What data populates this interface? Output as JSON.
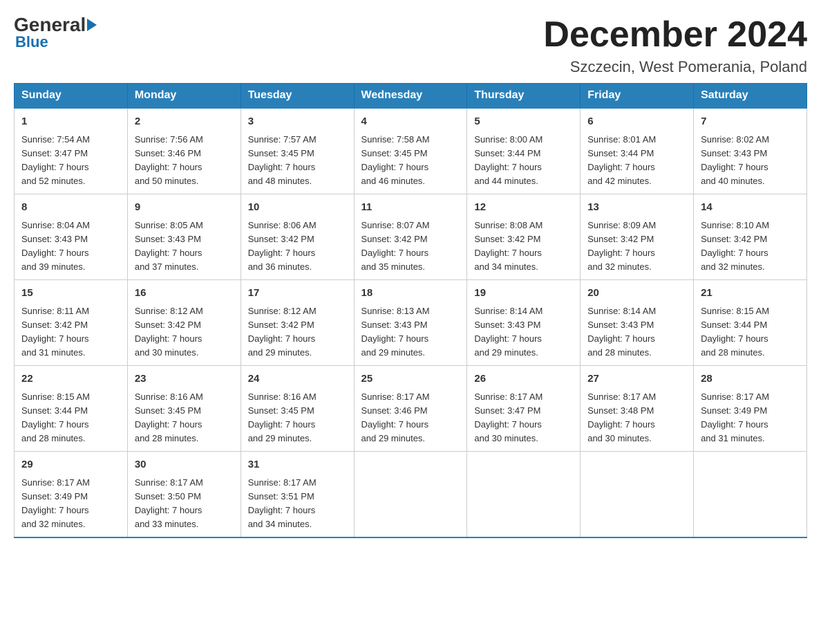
{
  "logo": {
    "general": "General",
    "blue": "Blue"
  },
  "title": "December 2024",
  "location": "Szczecin, West Pomerania, Poland",
  "weekdays": [
    "Sunday",
    "Monday",
    "Tuesday",
    "Wednesday",
    "Thursday",
    "Friday",
    "Saturday"
  ],
  "weeks": [
    [
      {
        "day": "1",
        "sunrise": "7:54 AM",
        "sunset": "3:47 PM",
        "daylight": "7 hours and 52 minutes."
      },
      {
        "day": "2",
        "sunrise": "7:56 AM",
        "sunset": "3:46 PM",
        "daylight": "7 hours and 50 minutes."
      },
      {
        "day": "3",
        "sunrise": "7:57 AM",
        "sunset": "3:45 PM",
        "daylight": "7 hours and 48 minutes."
      },
      {
        "day": "4",
        "sunrise": "7:58 AM",
        "sunset": "3:45 PM",
        "daylight": "7 hours and 46 minutes."
      },
      {
        "day": "5",
        "sunrise": "8:00 AM",
        "sunset": "3:44 PM",
        "daylight": "7 hours and 44 minutes."
      },
      {
        "day": "6",
        "sunrise": "8:01 AM",
        "sunset": "3:44 PM",
        "daylight": "7 hours and 42 minutes."
      },
      {
        "day": "7",
        "sunrise": "8:02 AM",
        "sunset": "3:43 PM",
        "daylight": "7 hours and 40 minutes."
      }
    ],
    [
      {
        "day": "8",
        "sunrise": "8:04 AM",
        "sunset": "3:43 PM",
        "daylight": "7 hours and 39 minutes."
      },
      {
        "day": "9",
        "sunrise": "8:05 AM",
        "sunset": "3:43 PM",
        "daylight": "7 hours and 37 minutes."
      },
      {
        "day": "10",
        "sunrise": "8:06 AM",
        "sunset": "3:42 PM",
        "daylight": "7 hours and 36 minutes."
      },
      {
        "day": "11",
        "sunrise": "8:07 AM",
        "sunset": "3:42 PM",
        "daylight": "7 hours and 35 minutes."
      },
      {
        "day": "12",
        "sunrise": "8:08 AM",
        "sunset": "3:42 PM",
        "daylight": "7 hours and 34 minutes."
      },
      {
        "day": "13",
        "sunrise": "8:09 AM",
        "sunset": "3:42 PM",
        "daylight": "7 hours and 32 minutes."
      },
      {
        "day": "14",
        "sunrise": "8:10 AM",
        "sunset": "3:42 PM",
        "daylight": "7 hours and 32 minutes."
      }
    ],
    [
      {
        "day": "15",
        "sunrise": "8:11 AM",
        "sunset": "3:42 PM",
        "daylight": "7 hours and 31 minutes."
      },
      {
        "day": "16",
        "sunrise": "8:12 AM",
        "sunset": "3:42 PM",
        "daylight": "7 hours and 30 minutes."
      },
      {
        "day": "17",
        "sunrise": "8:12 AM",
        "sunset": "3:42 PM",
        "daylight": "7 hours and 29 minutes."
      },
      {
        "day": "18",
        "sunrise": "8:13 AM",
        "sunset": "3:43 PM",
        "daylight": "7 hours and 29 minutes."
      },
      {
        "day": "19",
        "sunrise": "8:14 AM",
        "sunset": "3:43 PM",
        "daylight": "7 hours and 29 minutes."
      },
      {
        "day": "20",
        "sunrise": "8:14 AM",
        "sunset": "3:43 PM",
        "daylight": "7 hours and 28 minutes."
      },
      {
        "day": "21",
        "sunrise": "8:15 AM",
        "sunset": "3:44 PM",
        "daylight": "7 hours and 28 minutes."
      }
    ],
    [
      {
        "day": "22",
        "sunrise": "8:15 AM",
        "sunset": "3:44 PM",
        "daylight": "7 hours and 28 minutes."
      },
      {
        "day": "23",
        "sunrise": "8:16 AM",
        "sunset": "3:45 PM",
        "daylight": "7 hours and 28 minutes."
      },
      {
        "day": "24",
        "sunrise": "8:16 AM",
        "sunset": "3:45 PM",
        "daylight": "7 hours and 29 minutes."
      },
      {
        "day": "25",
        "sunrise": "8:17 AM",
        "sunset": "3:46 PM",
        "daylight": "7 hours and 29 minutes."
      },
      {
        "day": "26",
        "sunrise": "8:17 AM",
        "sunset": "3:47 PM",
        "daylight": "7 hours and 30 minutes."
      },
      {
        "day": "27",
        "sunrise": "8:17 AM",
        "sunset": "3:48 PM",
        "daylight": "7 hours and 30 minutes."
      },
      {
        "day": "28",
        "sunrise": "8:17 AM",
        "sunset": "3:49 PM",
        "daylight": "7 hours and 31 minutes."
      }
    ],
    [
      {
        "day": "29",
        "sunrise": "8:17 AM",
        "sunset": "3:49 PM",
        "daylight": "7 hours and 32 minutes."
      },
      {
        "day": "30",
        "sunrise": "8:17 AM",
        "sunset": "3:50 PM",
        "daylight": "7 hours and 33 minutes."
      },
      {
        "day": "31",
        "sunrise": "8:17 AM",
        "sunset": "3:51 PM",
        "daylight": "7 hours and 34 minutes."
      },
      null,
      null,
      null,
      null
    ]
  ],
  "labels": {
    "sunrise": "Sunrise:",
    "sunset": "Sunset:",
    "daylight": "Daylight:"
  }
}
